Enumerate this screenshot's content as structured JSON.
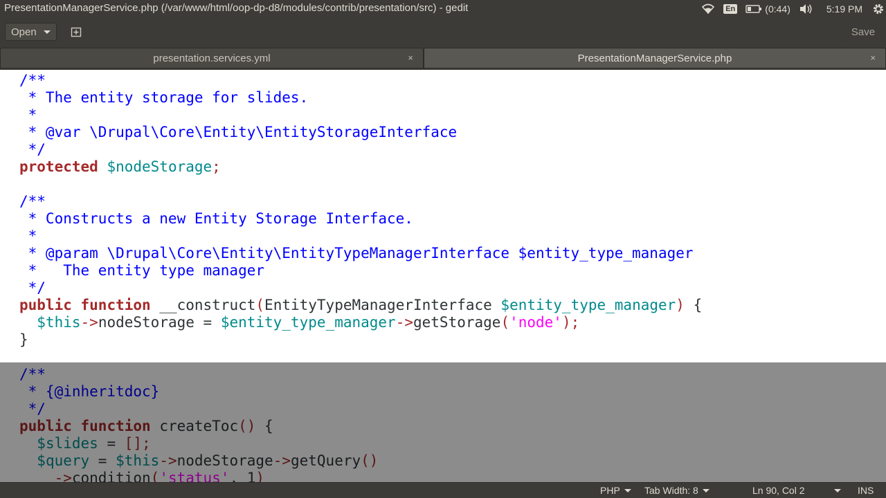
{
  "window": {
    "title": "PresentationManagerService.php (/var/www/html/oop-dp-d8/modules/contrib/presentation/src) - gedit"
  },
  "indicators": {
    "keyboard": "En",
    "battery": "(0:44)",
    "clock": "5:19 PM",
    "icons": [
      "wifi-icon",
      "battery-icon",
      "volume-icon",
      "settings-gear-icon"
    ]
  },
  "toolbar": {
    "open_label": "Open",
    "save_label": "Save",
    "new_tab_icon": "new-document-icon"
  },
  "tabs": [
    {
      "label": "presentation.services.yml",
      "close": "×",
      "active": false
    },
    {
      "label": "PresentationManagerService.php",
      "close": "×",
      "active": true
    }
  ],
  "code_lines": [
    [
      [
        "c",
        "/**"
      ]
    ],
    [
      [
        "c",
        " * The entity storage for slides."
      ]
    ],
    [
      [
        "c",
        " *"
      ]
    ],
    [
      [
        "c",
        " * @var \\Drupal\\Core\\Entity\\EntityStorageInterface"
      ]
    ],
    [
      [
        "c",
        " */"
      ]
    ],
    [
      [
        "kw",
        "protected"
      ],
      [
        "",
        " "
      ],
      [
        "var",
        "$nodeStorage"
      ],
      [
        "op",
        ";"
      ]
    ],
    [
      [
        "",
        ""
      ]
    ],
    [
      [
        "c",
        "/**"
      ]
    ],
    [
      [
        "c",
        " * Constructs a new Entity Storage Interface."
      ]
    ],
    [
      [
        "c",
        " *"
      ]
    ],
    [
      [
        "c",
        " * @param \\Drupal\\Core\\Entity\\EntityTypeManagerInterface $entity_type_manager"
      ]
    ],
    [
      [
        "c",
        " *   The entity type manager"
      ]
    ],
    [
      [
        "c",
        " */"
      ]
    ],
    [
      [
        "kw",
        "public"
      ],
      [
        "",
        " "
      ],
      [
        "kw",
        "function"
      ],
      [
        "",
        " __construct"
      ],
      [
        "op",
        "("
      ],
      [
        "",
        "EntityTypeManagerInterface "
      ],
      [
        "var",
        "$entity_type_manager"
      ],
      [
        "op",
        ")"
      ],
      [
        "",
        " {"
      ]
    ],
    [
      [
        "",
        "  "
      ],
      [
        "var",
        "$this"
      ],
      [
        "op",
        "->"
      ],
      [
        "",
        "nodeStorage = "
      ],
      [
        "var",
        "$entity_type_manager"
      ],
      [
        "op",
        "->"
      ],
      [
        "",
        "getStorage"
      ],
      [
        "op",
        "("
      ],
      [
        "str",
        "'node'"
      ],
      [
        "op",
        ")"
      ],
      [
        "op",
        ";"
      ]
    ],
    [
      [
        "",
        "}"
      ]
    ],
    [
      [
        "",
        ""
      ]
    ],
    [
      [
        "c",
        "/**"
      ]
    ],
    [
      [
        "c",
        " * {@inheritdoc}"
      ]
    ],
    [
      [
        "c",
        " */"
      ]
    ],
    [
      [
        "kw",
        "public"
      ],
      [
        "",
        " "
      ],
      [
        "kw",
        "function"
      ],
      [
        "",
        " createToc"
      ],
      [
        "op",
        "()"
      ],
      [
        "",
        " {"
      ]
    ],
    [
      [
        "",
        "  "
      ],
      [
        "var",
        "$slides"
      ],
      [
        "",
        " = "
      ],
      [
        "op",
        "[]"
      ],
      [
        "op",
        ";"
      ]
    ],
    [
      [
        "",
        "  "
      ],
      [
        "var",
        "$query"
      ],
      [
        "",
        " = "
      ],
      [
        "var",
        "$this"
      ],
      [
        "op",
        "->"
      ],
      [
        "",
        "nodeStorage"
      ],
      [
        "op",
        "->"
      ],
      [
        "",
        "getQuery"
      ],
      [
        "op",
        "()"
      ]
    ],
    [
      [
        "",
        "    "
      ],
      [
        "op",
        "->"
      ],
      [
        "",
        "condition"
      ],
      [
        "op",
        "("
      ],
      [
        "str",
        "'status'"
      ],
      [
        "",
        ", 1"
      ],
      [
        "op",
        ")"
      ]
    ]
  ],
  "statusbar": {
    "language": "PHP",
    "tab_width": "Tab Width: 8",
    "position": "Ln 90, Col 2",
    "mode": "INS"
  }
}
